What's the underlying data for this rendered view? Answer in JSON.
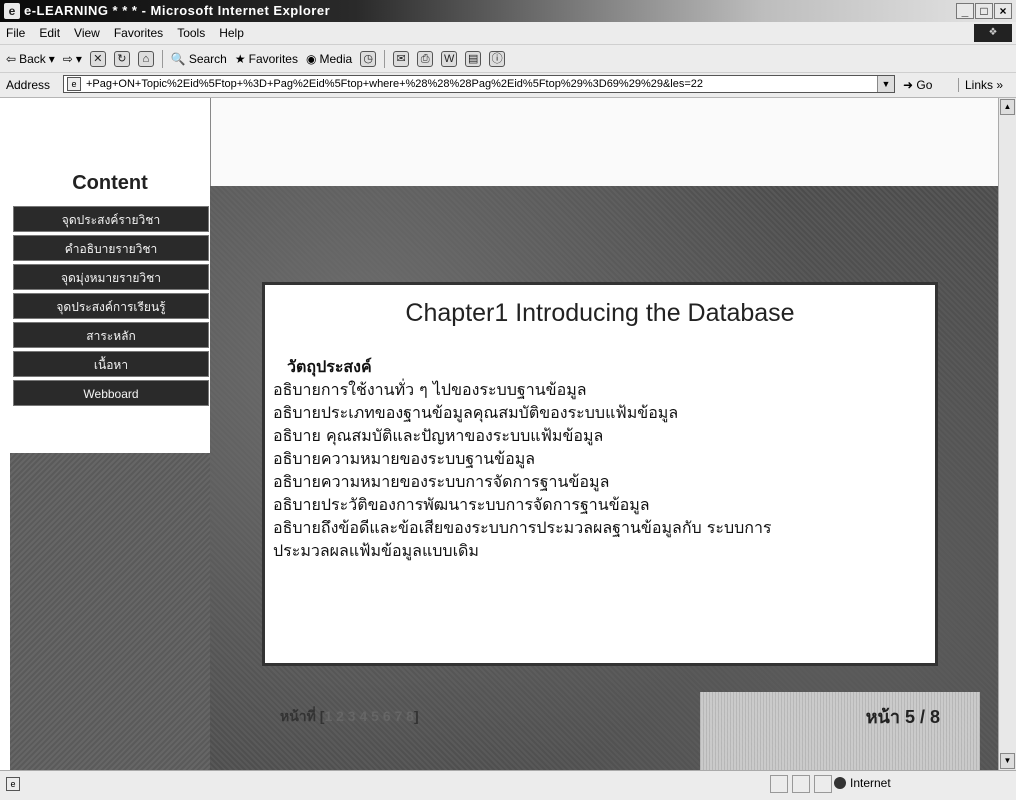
{
  "window": {
    "title": "e-LEARNING * * * - Microsoft Internet Explorer",
    "minimize": "_",
    "maximize": "□",
    "close": "×"
  },
  "menubar": {
    "items": [
      "File",
      "Edit",
      "View",
      "Favorites",
      "Tools",
      "Help"
    ]
  },
  "toolbar": {
    "back": "Back",
    "search": "Search",
    "favorites": "Favorites",
    "media": "Media"
  },
  "address": {
    "label": "Address",
    "url": "+Pag+ON+Topic%2Eid%5Ftop+%3D+Pag%2Eid%5Ftop+where+%28%28%28Pag%2Eid%5Ftop%29%3D69%29%29&les=22",
    "go": "Go",
    "links": "Links »"
  },
  "sidebar": {
    "heading": "Content",
    "items": [
      "จุดประสงค์รายวิชา",
      "คำอธิบายรายวิชา",
      "จุดมุ่งหมายรายวิชา",
      "จุดประสงค์การเรียนรู้",
      "สาระหลัก",
      "เนื้อหา",
      "Webboard"
    ]
  },
  "slide": {
    "title": "Chapter1 Introducing the Database",
    "objective_heading": "วัตถุประสงค์",
    "objectives": [
      "อธิบายการใช้งานทั่ว ๆ ไปของระบบฐานข้อมูล",
      "อธิบายประเภทของฐานข้อมูลคุณสมบัติของระบบแฟ้มข้อมูล",
      "อธิบาย คุณสมบัติและปัญหาของระบบแฟ้มข้อมูล",
      "อธิบายความหมายของระบบฐานข้อมูล",
      "อธิบายความหมายของระบบการจัดการฐานข้อมูล",
      "อธิบายประวัติของการพัฒนาระบบการจัดการฐานข้อมูล",
      "อธิบายถึงข้อดีและข้อเสียของระบบการประมวลผลฐานข้อมูลกับ ระบบการ",
      "ประมวลผลแฟ้มข้อมูลแบบเดิม"
    ]
  },
  "pager": {
    "label": "หน้าที่ [",
    "pages": "1 2 3 4 5 6 7 8",
    "close": "]",
    "current": "หน้า 5 / 8"
  },
  "statusbar": {
    "zone": "Internet"
  }
}
